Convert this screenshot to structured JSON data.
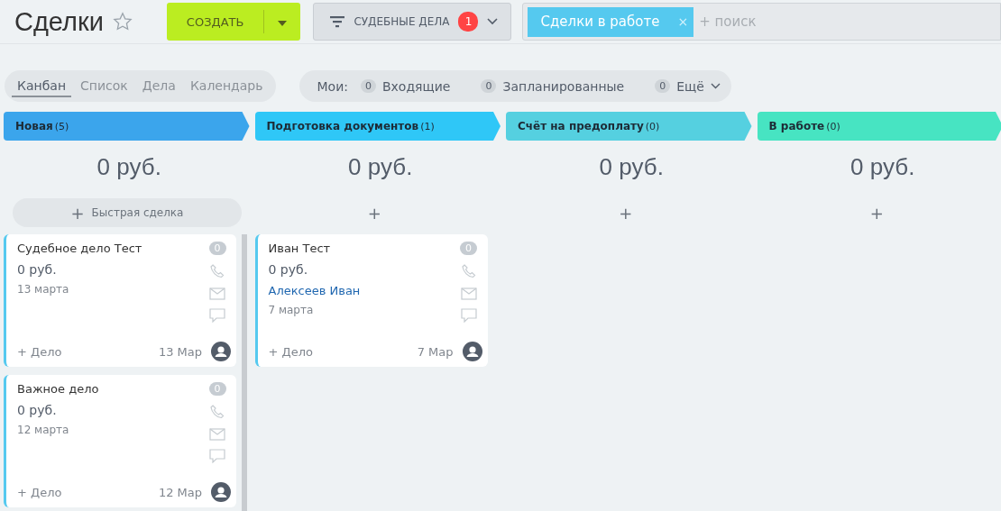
{
  "title": "Сделки",
  "create_button": {
    "label": "СОЗДАТЬ"
  },
  "filter_button": {
    "label": "СУДЕБНЫЕ ДЕЛА",
    "badge": "1"
  },
  "search": {
    "chip": "Сделки в работе",
    "chip_close": "×",
    "placeholder": "+ поиск"
  },
  "view_tabs": [
    {
      "label": "Канбан",
      "selected": true
    },
    {
      "label": "Список",
      "selected": false
    },
    {
      "label": "Дела",
      "selected": false
    },
    {
      "label": "Календарь",
      "selected": false
    }
  ],
  "my_filters": {
    "label": "Мои:",
    "items": [
      {
        "count": "0",
        "label": "Входящие",
        "kind": "plain"
      },
      {
        "count": "0",
        "label": "Запланированные",
        "kind": "plain"
      },
      {
        "count": "0",
        "label": "Ещё",
        "kind": "menu"
      }
    ]
  },
  "columns": [
    {
      "name": "Новая",
      "count": "(5)",
      "color": "#3ba5ec",
      "total": "0 руб.",
      "add_sign": "+",
      "add_label": "Быстрая сделка",
      "cards": [
        {
          "title": "Судебное дело Тест",
          "counter": "0",
          "amount": "0 руб.",
          "date": "13 марта",
          "add_task": "+ Дело",
          "short_date": "13 Мар"
        },
        {
          "title": "Важное дело",
          "counter": "0",
          "amount": "0 руб.",
          "date": "12 марта",
          "add_task": "+ Дело",
          "short_date": "12 Мар"
        }
      ]
    },
    {
      "name": "Подготовка документов",
      "count": "(1)",
      "color": "#2fc7f7",
      "total": "0 руб.",
      "add_sign": "+",
      "cards": [
        {
          "title": "Иван Тест",
          "counter": "0",
          "amount": "0 руб.",
          "contact": "Алексеев Иван",
          "date": "7 марта",
          "add_task": "+ Дело",
          "short_date": "7 Мар"
        }
      ]
    },
    {
      "name": "Счёт на предоплату",
      "count": "(0)",
      "color": "#55d0e0",
      "total": "0 руб.",
      "add_sign": "+"
    },
    {
      "name": "В работе",
      "count": "(0)",
      "color": "#47e4c2",
      "total": "0 руб.",
      "add_sign": "+"
    }
  ]
}
